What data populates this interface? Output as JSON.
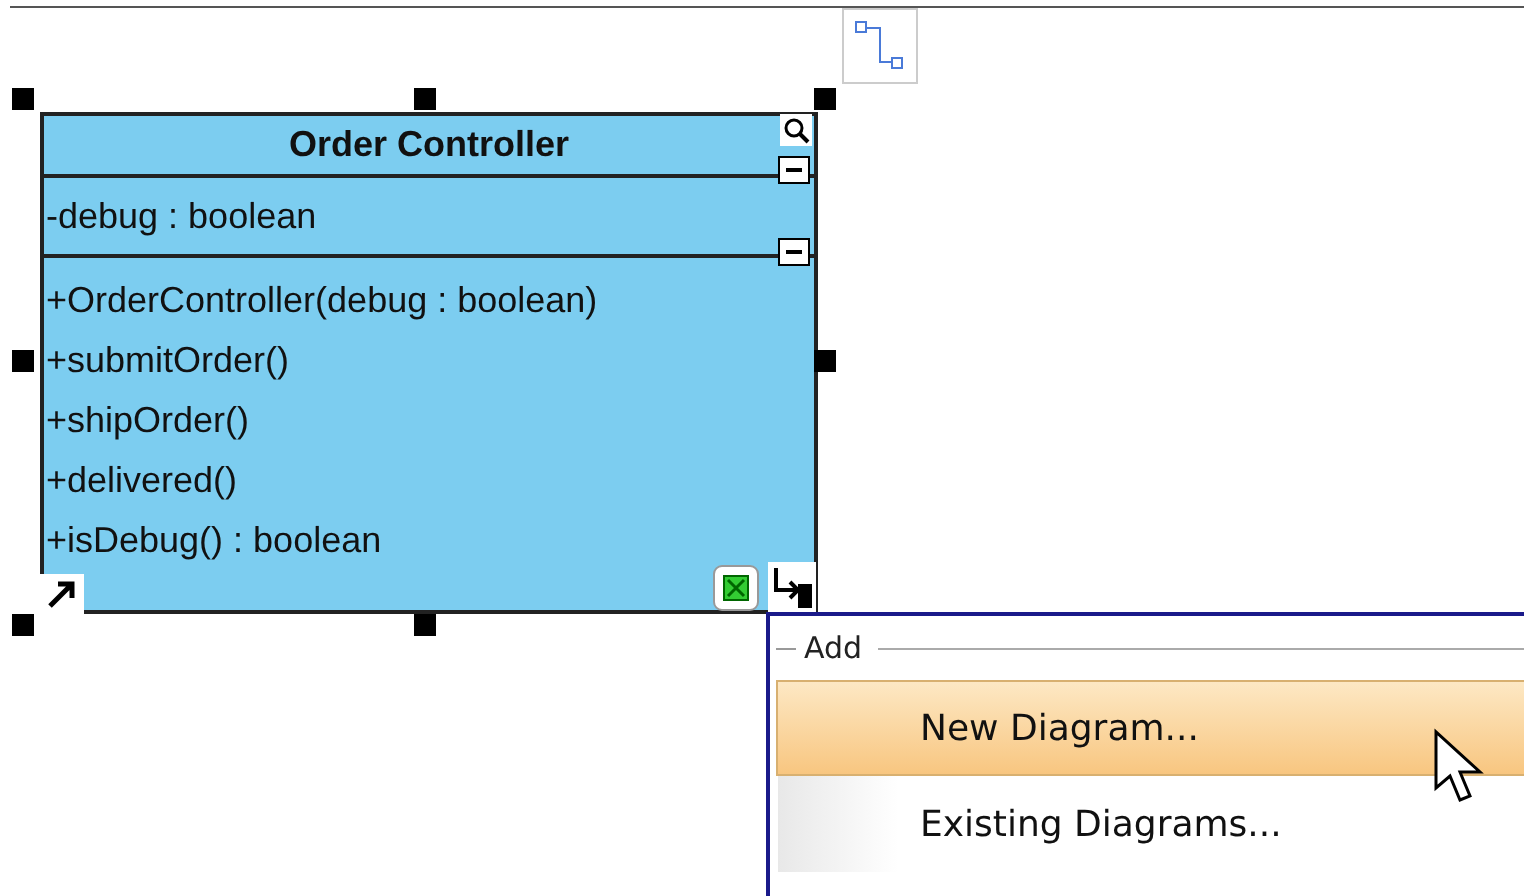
{
  "class": {
    "name": "Order Controller",
    "attributes": [
      "-debug : boolean"
    ],
    "operations": [
      "+OrderController(debug : boolean)",
      "+submitOrder()",
      "+shipOrder()",
      "+delivered()",
      "+isDebug() : boolean"
    ]
  },
  "menu": {
    "group": "Add",
    "items": [
      {
        "label": "New Diagram...",
        "selected": true
      },
      {
        "label": "Existing Diagrams...",
        "selected": false
      }
    ]
  }
}
